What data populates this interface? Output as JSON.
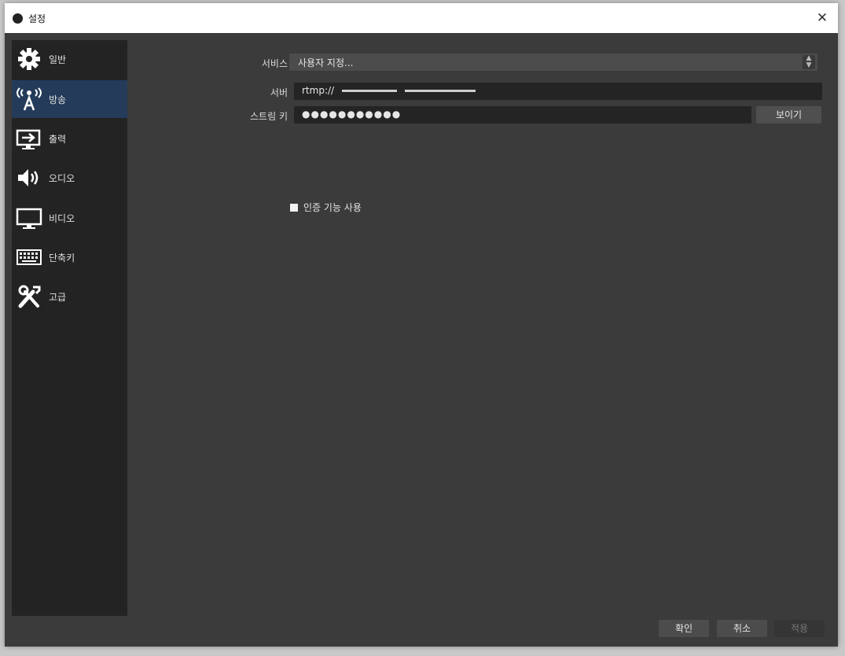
{
  "window": {
    "title": "설정",
    "close_glyph": "✕"
  },
  "sidebar": {
    "items": [
      {
        "label": "일반",
        "icon": "gear-icon"
      },
      {
        "label": "방송",
        "icon": "broadcast-icon",
        "active": true
      },
      {
        "label": "출력",
        "icon": "output-icon"
      },
      {
        "label": "오디오",
        "icon": "speaker-icon"
      },
      {
        "label": "비디오",
        "icon": "monitor-icon"
      },
      {
        "label": "단축키",
        "icon": "keyboard-icon"
      },
      {
        "label": "고급",
        "icon": "tools-icon"
      }
    ]
  },
  "stream": {
    "service_label": "서비스",
    "service_value": "사용자 지정...",
    "server_label": "서버",
    "server_value": "rtmp://",
    "key_label": "스트림 키",
    "key_value": "●●●●●●●●●●●",
    "show_button": "보이기",
    "auth_label": "인증 기능 사용"
  },
  "footer": {
    "ok": "확인",
    "cancel": "취소",
    "apply": "적용"
  },
  "colors": {
    "accent": "#243b5a",
    "window_bg": "#3b3b3b",
    "sidebar_bg": "#232323"
  }
}
